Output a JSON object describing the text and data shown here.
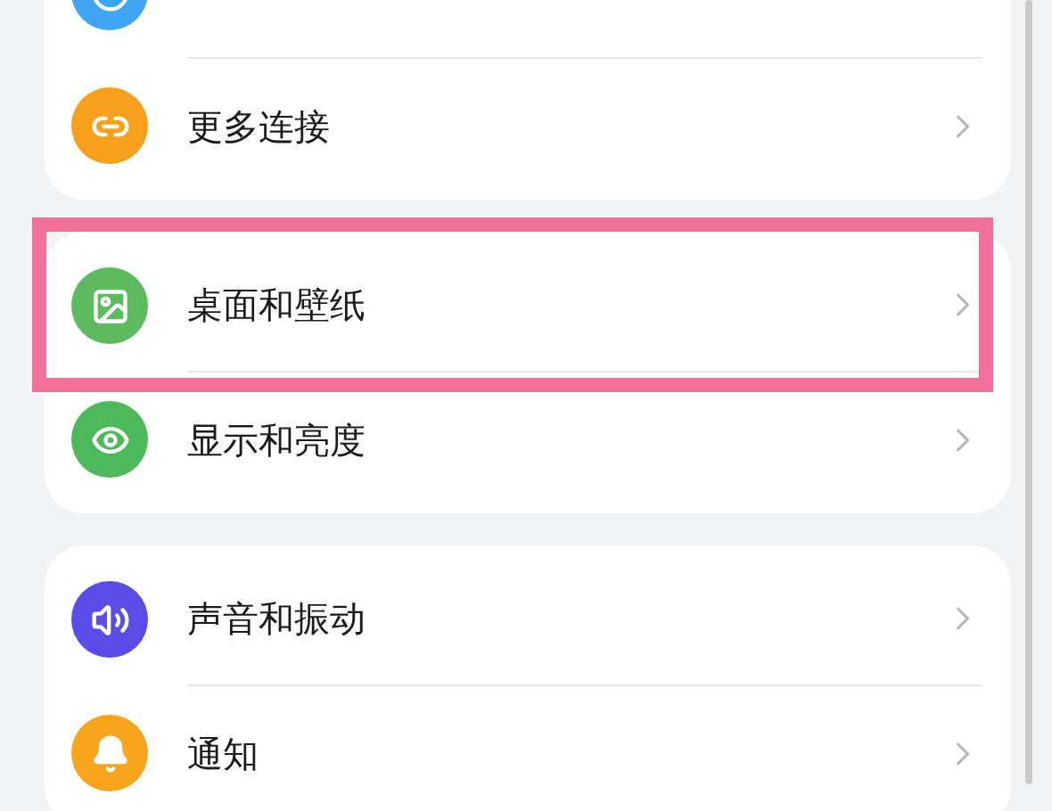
{
  "groups": [
    {
      "items": [
        {
          "color": "#3ea6f2",
          "highlighted": false
        },
        {
          "label": "更多连接",
          "color": "#f8a01c",
          "highlighted": false
        }
      ]
    },
    {
      "items": [
        {
          "label": "桌面和壁纸",
          "color": "#5cba5f",
          "highlighted": true
        },
        {
          "label": "显示和亮度",
          "color": "#4cb95a",
          "highlighted": false
        }
      ]
    },
    {
      "items": [
        {
          "label": "声音和振动",
          "color": "#5a4ce6",
          "highlighted": false
        },
        {
          "label": "通知",
          "color": "#f8a51b",
          "highlighted": false
        }
      ]
    }
  ]
}
